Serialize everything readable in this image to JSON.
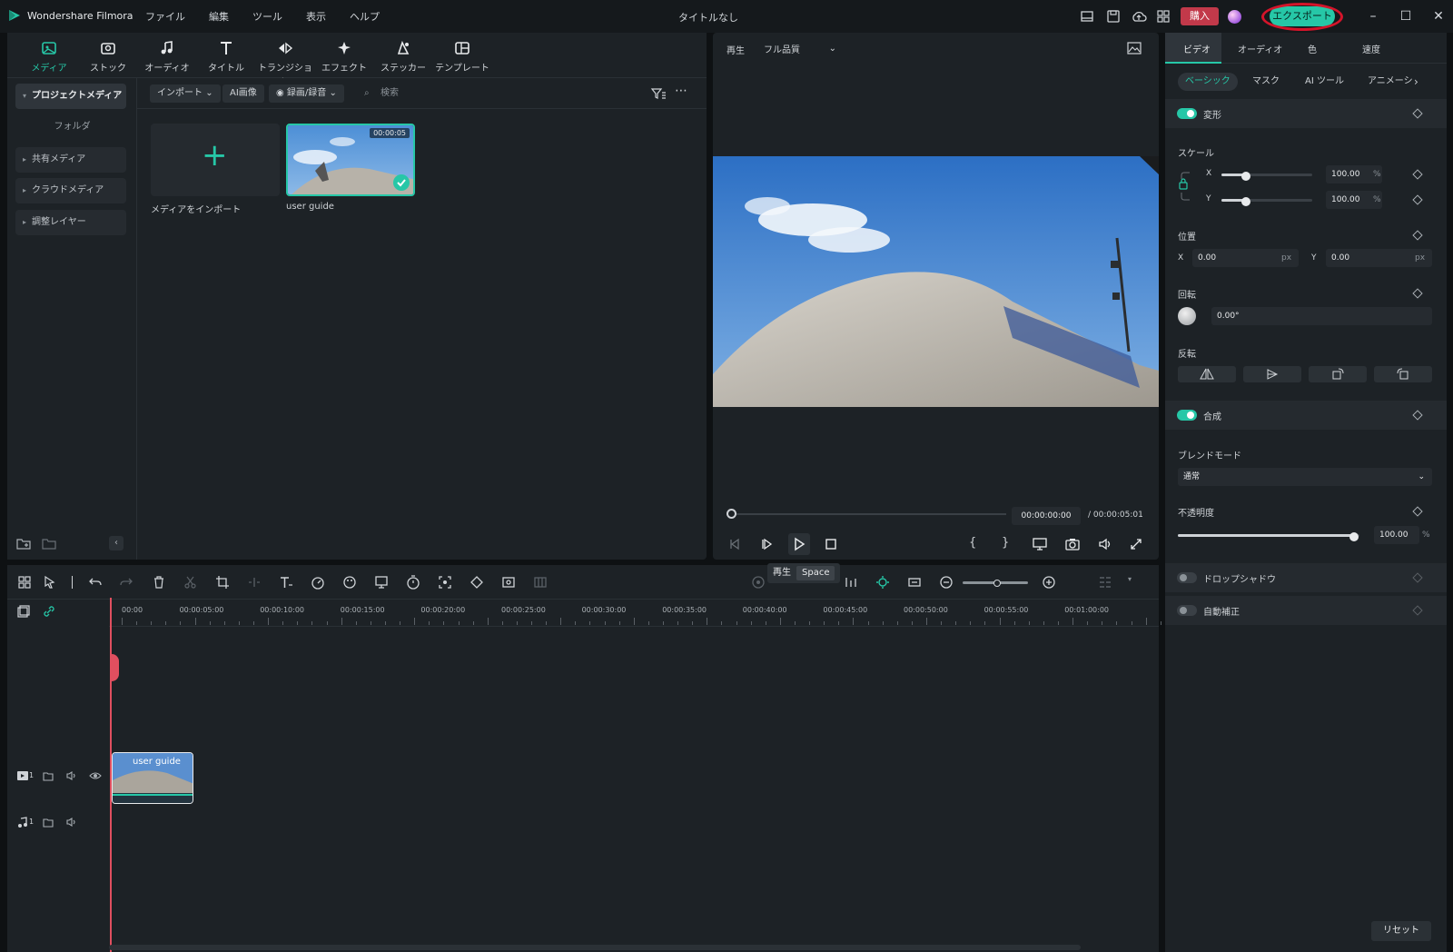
{
  "app": {
    "name": "Wondershare Filmora",
    "window_title": "タイトルなし",
    "menu": [
      "ファイル",
      "編集",
      "ツール",
      "表示",
      "ヘルプ"
    ],
    "buy_label": "購入",
    "export_label": "エクスポート"
  },
  "top_tabs": [
    {
      "label": "メディア",
      "icon": "media-icon"
    },
    {
      "label": "ストック",
      "icon": "stock-icon"
    },
    {
      "label": "オーディオ",
      "icon": "music-note-icon"
    },
    {
      "label": "タイトル",
      "icon": "title-text-icon"
    },
    {
      "label": "トランジション",
      "icon": "transition-icon"
    },
    {
      "label": "エフェクト",
      "icon": "effect-sparkle-icon"
    },
    {
      "label": "ステッカー",
      "icon": "sticker-icon"
    },
    {
      "label": "テンプレート",
      "icon": "template-icon"
    }
  ],
  "sidebar": {
    "project_media": "プロジェクトメディア",
    "folder": "フォルダ",
    "items": [
      "共有メディア",
      "クラウドメディア",
      "調整レイヤー"
    ]
  },
  "media_toolbar": {
    "import": "インポート",
    "ai_image": "AI画像",
    "record": "録画/録音",
    "search_placeholder": "検索"
  },
  "media_items": {
    "import_label": "メディアをインポート",
    "clip_label": "user guide",
    "clip_duration": "00:00:05"
  },
  "preview": {
    "play_label": "再生",
    "quality": "フル品質",
    "current_time": "00:00:00:00",
    "total_time": "/ 00:00:05:01",
    "tooltip_label": "再生",
    "tooltip_key": "Space"
  },
  "inspector": {
    "tabs": [
      "ビデオ",
      "オーディオ",
      "色",
      "速度"
    ],
    "sub_tabs": [
      "ベーシック",
      "マスク",
      "AI ツール",
      "アニメーシ"
    ],
    "transform": "変形",
    "scale": "スケール",
    "x": "X",
    "y": "Y",
    "scale_x_value": "100.00",
    "scale_y_value": "100.00",
    "percent": "%",
    "position": "位置",
    "pos_x_value": "0.00",
    "pos_y_value": "0.00",
    "px": "px",
    "rotation": "回転",
    "rotation_value": "0.00°",
    "flip": "反転",
    "composite": "合成",
    "blend_mode": "ブレンドモード",
    "blend_value": "通常",
    "opacity": "不透明度",
    "opacity_value": "100.00",
    "drop_shadow": "ドロップシャドウ",
    "auto_enhance": "自動補正",
    "reset": "リセット"
  },
  "timeline": {
    "ruler": [
      "00:00",
      "00:00:05:00",
      "00:00:10:00",
      "00:00:15:00",
      "00:00:20:00",
      "00:00:25:00",
      "00:00:30:00",
      "00:00:35:00",
      "00:00:40:00",
      "00:00:45:00",
      "00:00:50:00",
      "00:00:55:00",
      "00:01:00:00"
    ],
    "video_track_num": "1",
    "audio_track_num": "1",
    "clip_name": "user guide"
  },
  "colors": {
    "accent": "#26c7a7",
    "buy": "#c2394a",
    "playhead": "#e04f5f",
    "highlight_ring": "#d4142a"
  }
}
